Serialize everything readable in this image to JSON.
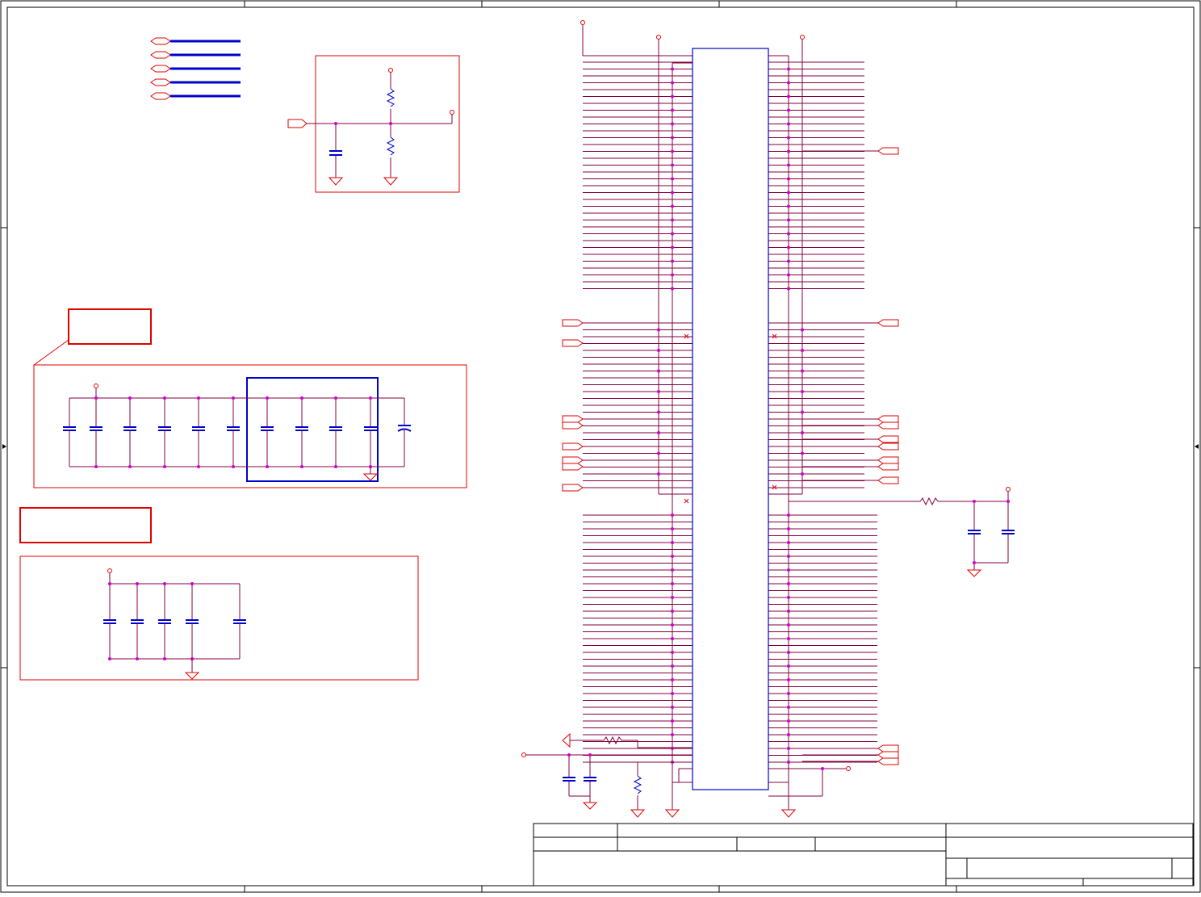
{
  "colors": {
    "frame": "#000000",
    "wire": "#800040",
    "part": "#0000cc",
    "port": "#e00000",
    "junction": "#d000d0"
  },
  "schematic": {
    "components": [
      "bus-connector",
      "resistor-divider",
      "decoupling-cap-bank",
      "bulk-cap-bank",
      "ic-connector",
      "filter-resistor",
      "filter-caps",
      "pullup-resistor",
      "title-block"
    ]
  }
}
